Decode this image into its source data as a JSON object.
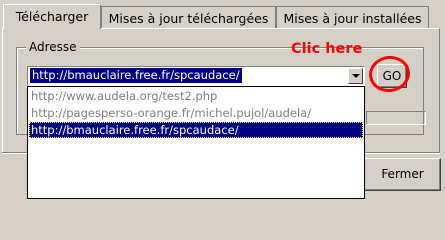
{
  "tabs": [
    {
      "label": "Télécharger"
    },
    {
      "label": "Mises à jour téléchargées"
    },
    {
      "label": "Mises à jour installées"
    }
  ],
  "address": {
    "group_label": "Adresse",
    "value": "http://bmauclaire.free.fr/spcaudace/",
    "options": [
      "http://www.audela.org/test2.php",
      "http://pagesperso-orange.fr/michel.pujol/audela/",
      "http://bmauclaire.free.fr/spcaudace/"
    ],
    "go_label": "GO"
  },
  "annotation": {
    "text": "Clic here",
    "color": "#ff0000"
  },
  "footer": {
    "close_label": "Fermer"
  },
  "colors": {
    "selection": "#000080",
    "window": "#d4d0c8"
  }
}
